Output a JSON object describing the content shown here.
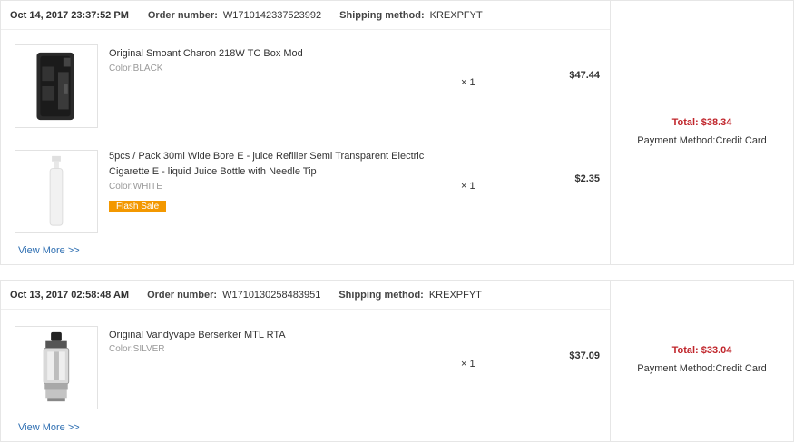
{
  "orders": [
    {
      "date": "Oct 14, 2017 23:37:52 PM",
      "order_number_label": "Order number:",
      "order_number": "W1710142337523992",
      "shipping_label": "Shipping method:",
      "shipping": "KREXPFYT",
      "items": [
        {
          "title": "Original Smoant Charon 218W TC Box Mod",
          "color": "Color:BLACK",
          "qty": "× 1",
          "price": "$47.44",
          "icon": "box-mod-image"
        },
        {
          "title": "5pcs / Pack 30ml Wide Bore E - juice Refiller Semi Transparent Electric Cigarette E - liquid Juice Bottle with Needle Tip",
          "color": "Color:WHITE",
          "badge": "Flash Sale",
          "qty": "× 1",
          "price": "$2.35",
          "icon": "bottle-image"
        }
      ],
      "view_more": "View More >>",
      "total": "Total: $38.34",
      "payment": "Payment Method:Credit Card"
    },
    {
      "date": "Oct 13, 2017 02:58:48 AM",
      "order_number_label": "Order number:",
      "order_number": "W1710130258483951",
      "shipping_label": "Shipping method:",
      "shipping": "KREXPFYT",
      "items": [
        {
          "title": "Original Vandyvape Berserker MTL RTA",
          "color": "Color:SILVER",
          "qty": "× 1",
          "price": "$37.09",
          "icon": "tank-image"
        }
      ],
      "view_more": "View More >>",
      "total": "Total: $33.04",
      "payment": "Payment Method:Credit Card"
    }
  ],
  "colors": {
    "total_red": "#c0252b",
    "link_blue": "#2f6fb2",
    "flash_orange": "#f39800",
    "border": "#e6e6e6"
  }
}
